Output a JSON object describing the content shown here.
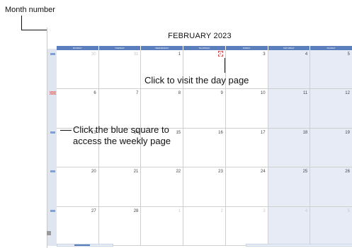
{
  "callouts": {
    "month_number": "Month number",
    "day_page": "Click to visit the day page",
    "week_page_line1": "Click the blue square to",
    "week_page_line2": "access the weekly page"
  },
  "calendar": {
    "title_month": "FEBRUARY",
    "title_year": "2023",
    "weekday_headers": [
      "MONDAY",
      "TUESDAY",
      "WEDNESDAY",
      "THURSDAY",
      "FRIDAY",
      "SATURDAY",
      "SUNDAY"
    ],
    "weeks": [
      [
        "30",
        "31",
        "1",
        "2",
        "3",
        "4",
        "5"
      ],
      [
        "6",
        "7",
        "8",
        "9",
        "10",
        "11",
        "12"
      ],
      [
        "13",
        "14",
        "15",
        "16",
        "17",
        "18",
        "19"
      ],
      [
        "20",
        "21",
        "22",
        "23",
        "24",
        "25",
        "26"
      ],
      [
        "27",
        "28",
        "1",
        "2",
        "3",
        "4",
        "5"
      ]
    ]
  }
}
